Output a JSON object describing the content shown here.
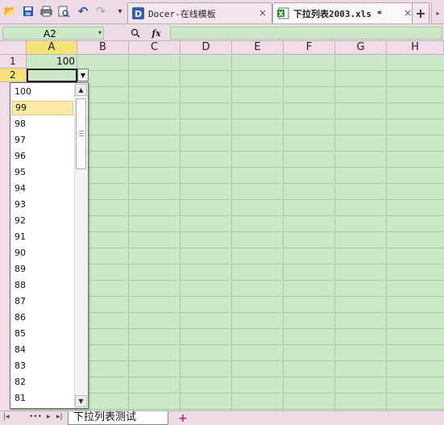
{
  "toolbar": {
    "items": [
      {
        "icon": "open-folder-icon",
        "glyph": "📂"
      },
      {
        "icon": "save-icon",
        "glyph": "💾"
      },
      {
        "icon": "print-icon",
        "glyph": "🖶"
      },
      {
        "icon": "print-preview-icon",
        "glyph": "🔍"
      },
      {
        "icon": "undo-icon",
        "glyph": "↶"
      },
      {
        "icon": "redo-icon",
        "glyph": "↷"
      },
      {
        "icon": "customize-toolbar-icon",
        "glyph": "▾"
      }
    ]
  },
  "tabs": [
    {
      "label": "Docer-在线模板",
      "close": "×",
      "icon": "docer-icon"
    },
    {
      "label": "下拉列表2003.xls *",
      "close": "×",
      "icon": "spreadsheet-file-icon"
    }
  ],
  "new_tab": "+",
  "formula_bar": {
    "cell_ref": "A2",
    "zoom_icon": "🔍",
    "fx_label": "fx"
  },
  "columns": [
    "A",
    "B",
    "C",
    "D",
    "E",
    "F",
    "G",
    "H"
  ],
  "rows": [
    "1",
    "2"
  ],
  "cells": {
    "A1": "100"
  },
  "dropdown": {
    "options": [
      "100",
      "99",
      "98",
      "97",
      "96",
      "95",
      "94",
      "93",
      "92",
      "91",
      "90",
      "89",
      "88",
      "87",
      "86",
      "85",
      "84",
      "83",
      "82",
      "81"
    ],
    "highlighted": "99"
  },
  "sheetbar": {
    "nav": [
      "|◂",
      "•••",
      "▸",
      "▸|"
    ],
    "sheet_name": "下拉列表测试",
    "add_sheet": "+"
  }
}
